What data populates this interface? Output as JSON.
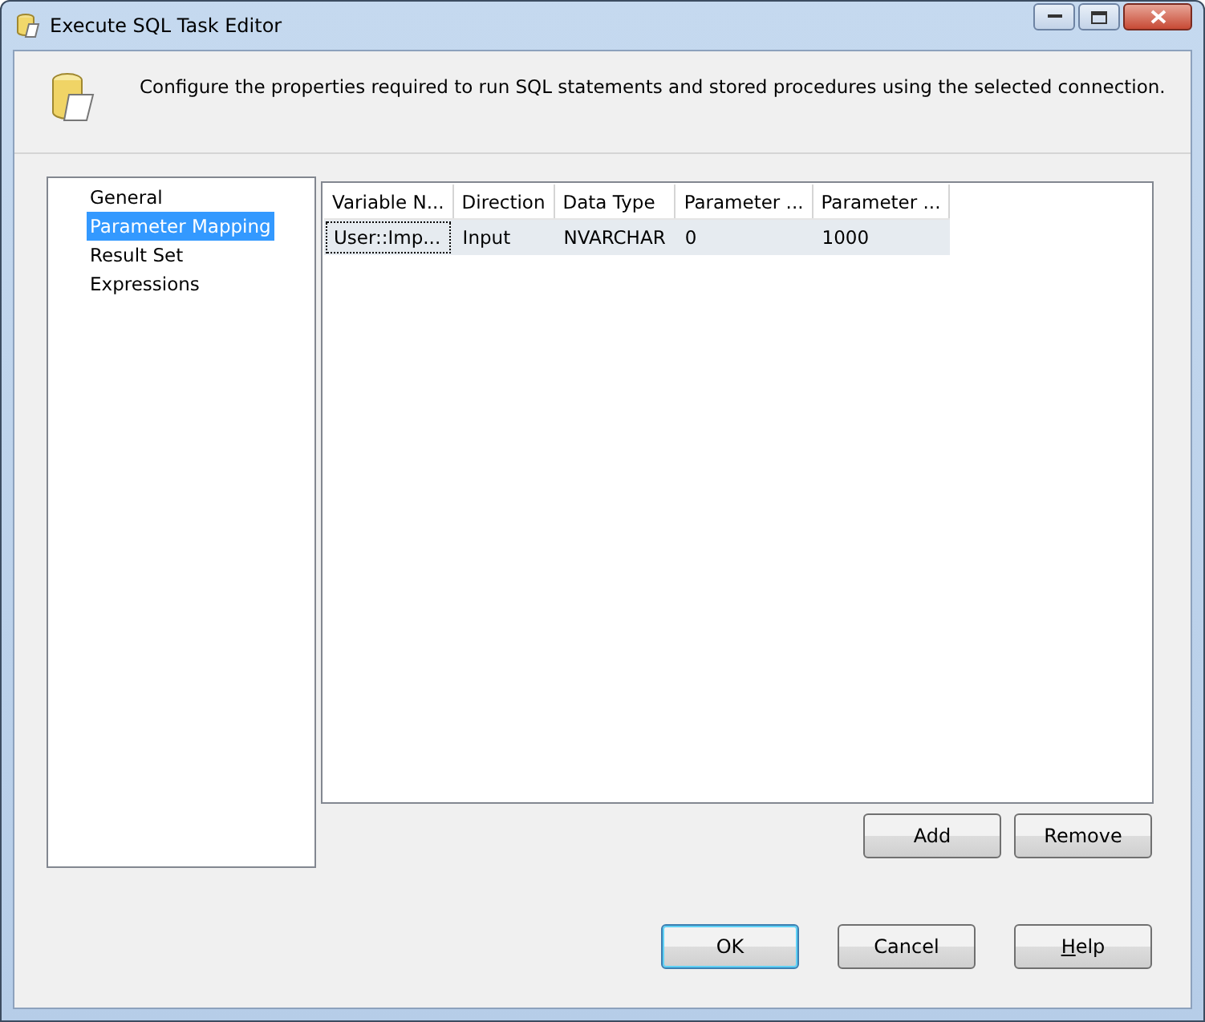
{
  "window": {
    "title": "Execute SQL Task Editor"
  },
  "header": {
    "description": "Configure the properties required to run SQL statements and stored procedures using the selected connection."
  },
  "pages": [
    {
      "label": "General",
      "selected": false
    },
    {
      "label": "Parameter Mapping",
      "selected": true
    },
    {
      "label": "Result Set",
      "selected": false
    },
    {
      "label": "Expressions",
      "selected": false
    }
  ],
  "table": {
    "columns": [
      "Variable N...",
      "Direction",
      "Data Type",
      "Parameter ...",
      "Parameter ..."
    ],
    "rows": [
      {
        "cells": [
          "User::Imp...",
          "Input",
          "NVARCHAR",
          "0",
          "1000"
        ],
        "selected": true
      }
    ]
  },
  "grid_buttons": [
    {
      "label": "Add"
    },
    {
      "label": "Remove"
    }
  ],
  "buttons": [
    {
      "label": "OK",
      "default": true,
      "underline_first": false
    },
    {
      "label": "Cancel",
      "default": false,
      "underline_first": false
    },
    {
      "label": "Help",
      "default": false,
      "underline_first": true
    }
  ]
}
